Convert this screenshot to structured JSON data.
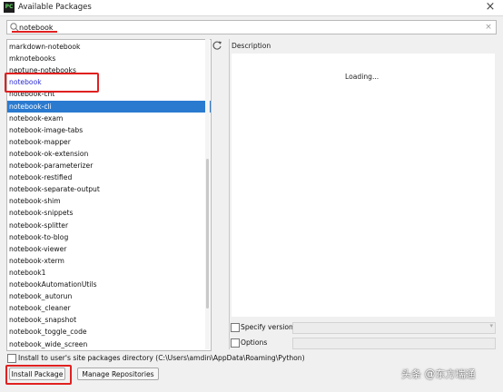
{
  "window": {
    "title": "Available Packages"
  },
  "search": {
    "value": "notebook",
    "placeholder": ""
  },
  "packages": [
    {
      "name": "markdown-notebook",
      "state": "normal"
    },
    {
      "name": "mknotebooks",
      "state": "normal"
    },
    {
      "name": "neptune-notebooks",
      "state": "normal"
    },
    {
      "name": "notebook",
      "state": "installed"
    },
    {
      "name": "notebook-cht",
      "state": "normal"
    },
    {
      "name": "notebook-cli",
      "state": "selected"
    },
    {
      "name": "notebook-exam",
      "state": "normal"
    },
    {
      "name": "notebook-image-tabs",
      "state": "normal"
    },
    {
      "name": "notebook-mapper",
      "state": "normal"
    },
    {
      "name": "notebook-ok-extension",
      "state": "normal"
    },
    {
      "name": "notebook-parameterizer",
      "state": "normal"
    },
    {
      "name": "notebook-restified",
      "state": "normal"
    },
    {
      "name": "notebook-separate-output",
      "state": "normal"
    },
    {
      "name": "notebook-shim",
      "state": "normal"
    },
    {
      "name": "notebook-snippets",
      "state": "normal"
    },
    {
      "name": "notebook-splitter",
      "state": "normal"
    },
    {
      "name": "notebook-to-blog",
      "state": "normal"
    },
    {
      "name": "notebook-viewer",
      "state": "normal"
    },
    {
      "name": "notebook-xterm",
      "state": "normal"
    },
    {
      "name": "notebook1",
      "state": "normal"
    },
    {
      "name": "notebookAutomationUtils",
      "state": "normal"
    },
    {
      "name": "notebook_autorun",
      "state": "normal"
    },
    {
      "name": "notebook_cleaner",
      "state": "normal"
    },
    {
      "name": "notebook_snapshot",
      "state": "normal"
    },
    {
      "name": "notebook_toggle_code",
      "state": "normal"
    },
    {
      "name": "notebook_wide_screen",
      "state": "normal"
    }
  ],
  "description": {
    "label": "Description",
    "status": "Loading..."
  },
  "options": {
    "specify_version_label": "Specify version",
    "options_label": "Options",
    "specify_version_checked": false,
    "options_checked": false
  },
  "install_to_user_site": {
    "label": "Install to user's site packages directory (C:\\Users\\amdin\\AppData\\Roaming\\Python)",
    "checked": false
  },
  "buttons": {
    "install": "Install Package",
    "manage": "Manage Repositories"
  },
  "watermark": {
    "prefix": "头条",
    "at": "@",
    "name": "东方瑞通"
  },
  "colors": {
    "selection": "#2a7ad0",
    "installed_text": "#2a2ad4",
    "highlight_annotation": "#e02020"
  },
  "icons": {
    "app": "pycharm-icon",
    "search": "search-icon",
    "clear": "clear-icon",
    "refresh": "refresh-icon",
    "close": "close-icon"
  }
}
